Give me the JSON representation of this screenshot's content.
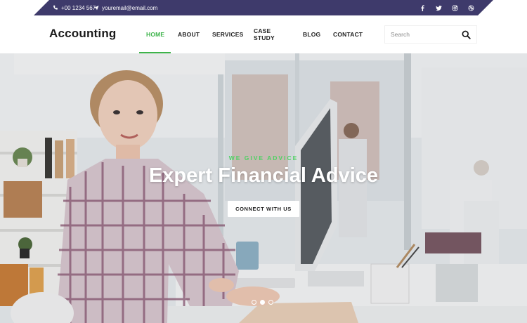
{
  "topbar": {
    "phone": "+00 1234 567",
    "email": "youremail@email.com",
    "social": [
      "facebook-icon",
      "twitter-icon",
      "instagram-icon",
      "dribbble-icon"
    ]
  },
  "header": {
    "brand": "Accounting",
    "nav": [
      {
        "label": "HOME",
        "active": true
      },
      {
        "label": "ABOUT",
        "active": false
      },
      {
        "label": "SERVICES",
        "active": false
      },
      {
        "label": "CASE STUDY",
        "active": false
      },
      {
        "label": "BLOG",
        "active": false
      },
      {
        "label": "CONTACT",
        "active": false
      }
    ],
    "search": {
      "placeholder": "Search",
      "value": ""
    }
  },
  "hero": {
    "kicker": "WE GIVE ADVICE",
    "title": "Expert Financial Advice",
    "button": "CONNECT WITH US",
    "slides": 3,
    "active_slide": 2
  },
  "colors": {
    "topbar": "#3e3a6b",
    "accent": "#3db34a",
    "kicker": "#4fd163"
  }
}
